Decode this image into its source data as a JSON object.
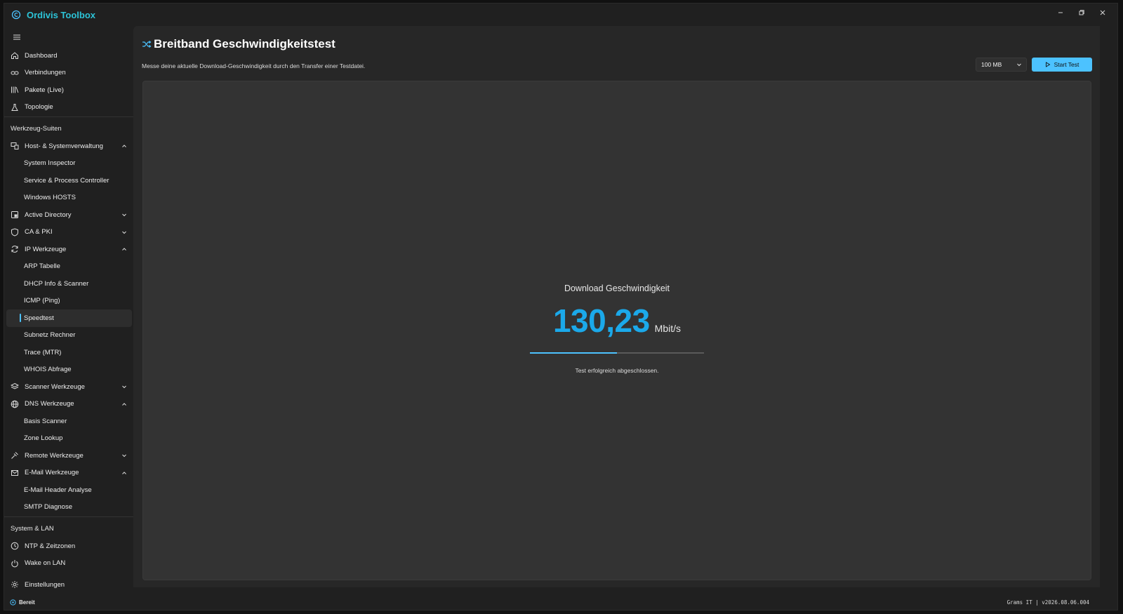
{
  "app": {
    "title": "Ordivis Toolbox",
    "accent": "#4cc2ff",
    "brand_color": "#2cc4d8"
  },
  "sidebar": {
    "top_items": [
      {
        "label": "Dashboard",
        "icon": "home-icon"
      },
      {
        "label": "Verbindungen",
        "icon": "link-icon"
      },
      {
        "label": "Pakete (Live)",
        "icon": "library-icon"
      },
      {
        "label": "Topologie",
        "icon": "flask-icon"
      }
    ],
    "section_tools": "Werkzeug-Suiten",
    "groups": {
      "host": {
        "label": "Host- & Systemverwaltung",
        "children": [
          "System Inspector",
          "Service & Process Controller",
          "Windows HOSTS"
        ]
      },
      "ad": {
        "label": "Active Directory"
      },
      "ca": {
        "label": "CA & PKI"
      },
      "ip": {
        "label": "IP Werkzeuge",
        "children": [
          "ARP Tabelle",
          "DHCP Info & Scanner",
          "ICMP (Ping)",
          "Speedtest",
          "Subnetz Rechner",
          "Trace (MTR)",
          "WHOIS Abfrage"
        ]
      },
      "scanner": {
        "label": "Scanner Werkzeuge"
      },
      "dns": {
        "label": "DNS Werkzeuge",
        "children": [
          "Basis Scanner",
          "Zone Lookup"
        ]
      },
      "remote": {
        "label": "Remote Werkzeuge"
      },
      "mail": {
        "label": "E-Mail Werkzeuge",
        "children": [
          "E-Mail Header Analyse",
          "SMTP Diagnose"
        ]
      }
    },
    "section_system": "System & LAN",
    "system_items": [
      {
        "label": "NTP & Zeitzonen",
        "icon": "clock-icon"
      },
      {
        "label": "Wake on LAN",
        "icon": "power-icon"
      }
    ],
    "settings_label": "Einstellungen"
  },
  "page": {
    "title": "Breitband Geschwindigkeitstest",
    "description": "Messe deine aktuelle Download-Geschwindigkeit durch den Transfer einer Testdatei.",
    "size_selected": "100 MB",
    "start_label": "Start Test"
  },
  "result": {
    "label": "Download Geschwindigkeit",
    "value": "130,23",
    "unit": "Mbit/s",
    "progress_fraction": 0.5,
    "status": "Test erfolgreich abgeschlossen."
  },
  "statusbar": {
    "state": "Bereit",
    "version": "Grams IT | v2026.08.06.004"
  }
}
